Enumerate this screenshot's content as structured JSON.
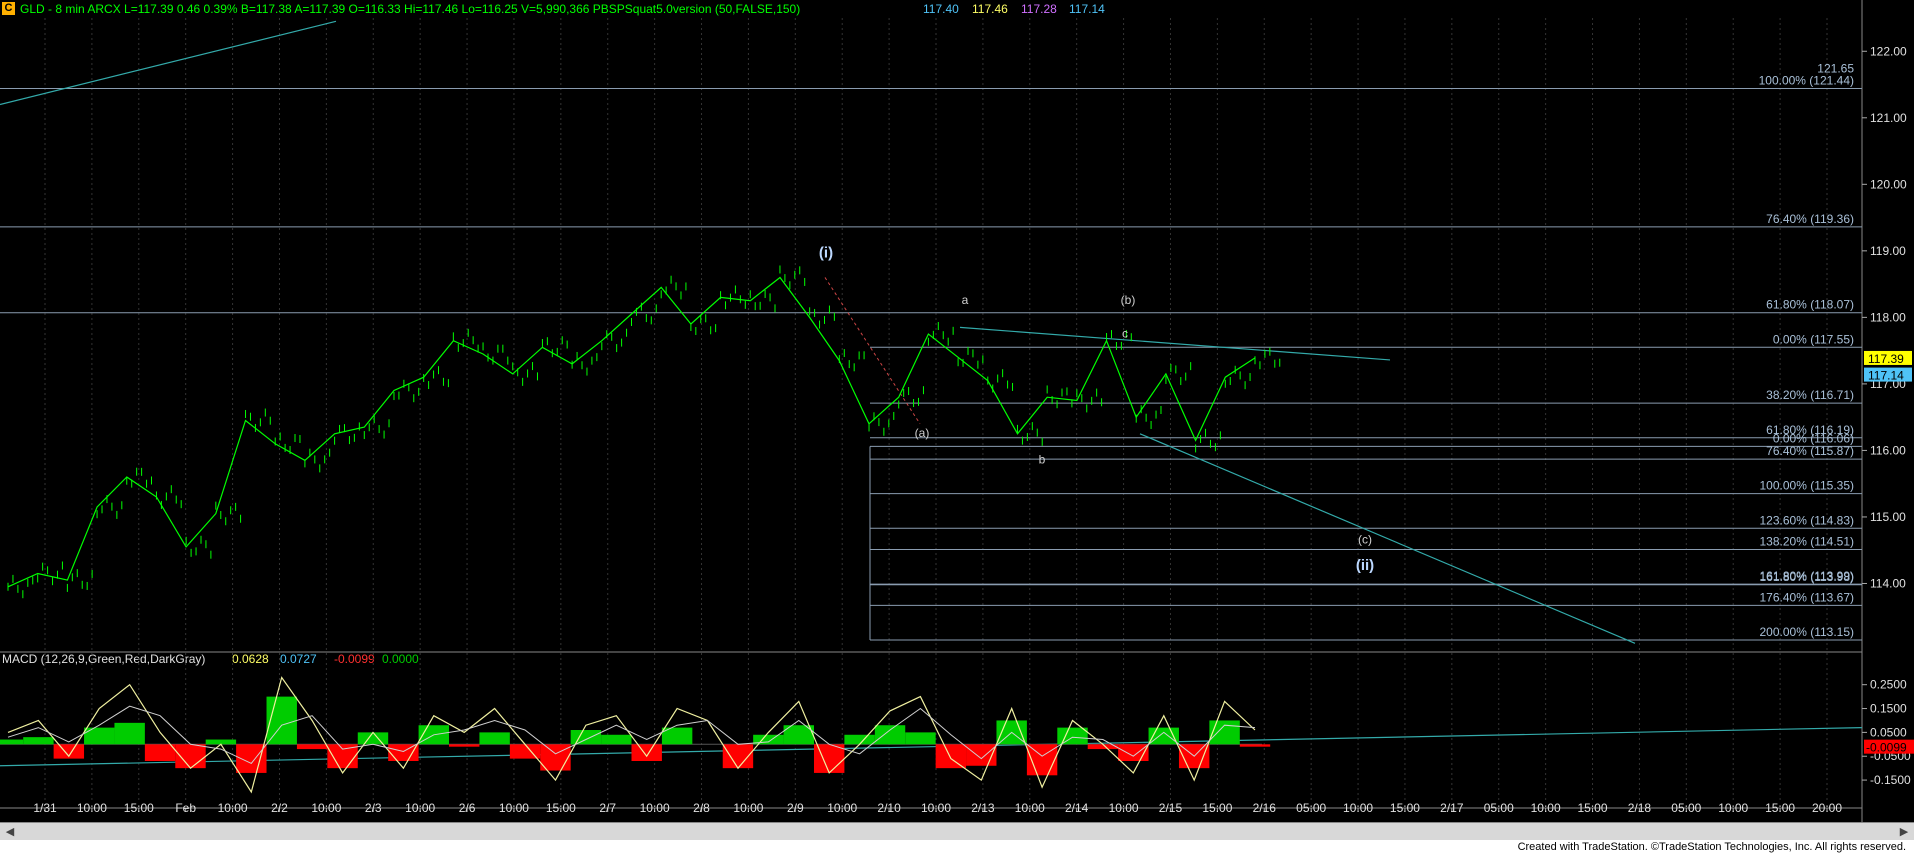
{
  "header": {
    "badge": "C",
    "symbol_info": "GLD - 8 min  ARCX  L=117.39  0.46  0.39%  B=117.38  A=117.39  O=116.33  Hi=117.46  Lo=116.25  V=5,990,366  PBSPSquat5.0version (50,FALSE,150)",
    "study_values": [
      "117.40",
      "117.46",
      "117.28",
      "117.14"
    ],
    "study_colors": [
      "#4fc3f7",
      "#ffff66",
      "#d070ff",
      "#4fc3f7"
    ]
  },
  "macd_header": {
    "label": "MACD (12,26,9,Green,Red,DarkGray)",
    "values": [
      "0.0628",
      "0.0727",
      "-0.0099",
      "0.0000"
    ],
    "colors": [
      "#ffff66",
      "#4fc3f7",
      "#ff3030",
      "#00cc00"
    ]
  },
  "footer": {
    "text": "Created with TradeStation. ©TradeStation Technologies, Inc. All rights reserved."
  },
  "colors": {
    "background": "#000000",
    "price_bars": "#00ff00",
    "fib_lines": "#8a9cb0",
    "trendlines": "#33aaaa",
    "macd_line": "#f0f0a0",
    "signal_line": "#d0d0d0",
    "hist_pos": "#00cc00",
    "hist_neg": "#ff0000"
  },
  "chart_data": [
    {
      "type": "line",
      "title": "GLD - 8 min",
      "x": [
        "1/31",
        "10:00",
        "15:00",
        "Feb",
        "10:00",
        "2/2",
        "10:00",
        "2/3",
        "10:00",
        "2/6",
        "10:00",
        "15:00",
        "2/7",
        "10:00",
        "2/8",
        "10:00",
        "2/9",
        "10:00",
        "2/10",
        "10:00",
        "2/13",
        "10:00",
        "2/14",
        "10:00",
        "2/15",
        "15:00",
        "2/16",
        "05:00",
        "10:00",
        "15:00",
        "2/17",
        "05:00",
        "10:00",
        "15:00",
        "2/18",
        "05:00",
        "10:00",
        "15:00",
        "20:00"
      ],
      "yaxis_ticks": [
        "122.00",
        "121.00",
        "120.00",
        "119.00",
        "118.00",
        "117.00",
        "116.00",
        "115.00",
        "114.00"
      ],
      "ylim": [
        113.0,
        122.5
      ],
      "series": [
        {
          "values": [
            113.95,
            114.15,
            114.05,
            115.15,
            115.6,
            115.3,
            114.55,
            115.05,
            116.45,
            116.1,
            115.85,
            116.25,
            116.35,
            116.9,
            117.1,
            117.65,
            117.45,
            117.15,
            117.55,
            117.3,
            117.65,
            118.05,
            118.45,
            117.9,
            118.3,
            118.25,
            118.6,
            118.0,
            117.35,
            116.4,
            116.8,
            117.75,
            117.4,
            117.05,
            116.25,
            116.8,
            116.75,
            117.65,
            116.5,
            117.15,
            116.15,
            117.1,
            117.39
          ]
        }
      ],
      "last_price_labels": [
        "117.39",
        "117.14"
      ],
      "top_line_label": "121.65",
      "fib_levels": [
        {
          "text": "100.00% (121.44)",
          "value": 121.44
        },
        {
          "text": "76.40% (119.36)",
          "value": 119.36
        },
        {
          "text": "61.80% (118.07)",
          "value": 118.07
        },
        {
          "text": "0.00% (117.55)",
          "value": 117.55
        },
        {
          "text": "38.20% (116.71)",
          "value": 116.71
        },
        {
          "text": "61.80% (116.19)",
          "value": 116.19
        },
        {
          "text": "0.00% (116.06)",
          "value": 116.06
        },
        {
          "text": "76.40% (115.87)",
          "value": 115.87
        },
        {
          "text": "100.00% (115.35)",
          "value": 115.35
        },
        {
          "text": "123.60% (114.83)",
          "value": 114.83
        },
        {
          "text": "138.20% (114.51)",
          "value": 114.51
        },
        {
          "text": "161.80% (113.99)",
          "value": 113.99
        },
        {
          "text": "161.80% (113.98)",
          "value": 113.98
        },
        {
          "text": "176.40% (113.67)",
          "value": 113.67
        },
        {
          "text": "200.00% (113.15)",
          "value": 113.15
        }
      ],
      "wave_labels": [
        "(i)",
        "a",
        "(b)",
        "c",
        "(a)",
        "b",
        "(c)",
        "(ii)"
      ]
    },
    {
      "type": "line",
      "title": "MACD (12,26,9,Green,Red,DarkGray)",
      "yaxis_ticks": [
        "0.2500",
        "0.1500",
        "0.0500",
        "-0.0500",
        "-0.1500"
      ],
      "ylim": [
        -0.2,
        0.32
      ],
      "last_value_label": "-0.0099",
      "series": [
        {
          "name": "MACD",
          "values": [
            0.05,
            0.1,
            -0.05,
            0.15,
            0.25,
            0.05,
            -0.1,
            0.0,
            -0.2,
            0.28,
            0.1,
            -0.12,
            0.05,
            -0.1,
            0.12,
            0.05,
            0.15,
            0.0,
            -0.15,
            0.08,
            0.12,
            -0.05,
            0.15,
            0.1,
            -0.1,
            0.05,
            0.18,
            -0.12,
            0.0,
            0.14,
            0.2,
            -0.06,
            -0.15,
            0.15,
            -0.18,
            0.1,
            0.0,
            -0.12,
            0.12,
            -0.15,
            0.18,
            0.06
          ]
        },
        {
          "name": "Signal",
          "values": [
            0.03,
            0.07,
            0.01,
            0.08,
            0.16,
            0.12,
            0.0,
            -0.02,
            -0.08,
            0.08,
            0.12,
            -0.02,
            0.0,
            -0.03,
            0.04,
            0.06,
            0.1,
            0.06,
            -0.04,
            0.02,
            0.08,
            0.02,
            0.08,
            0.1,
            0.0,
            0.01,
            0.1,
            0.0,
            -0.04,
            0.06,
            0.15,
            0.04,
            -0.06,
            0.05,
            -0.05,
            0.03,
            0.02,
            -0.05,
            0.05,
            -0.05,
            0.08,
            0.07
          ]
        }
      ]
    }
  ]
}
